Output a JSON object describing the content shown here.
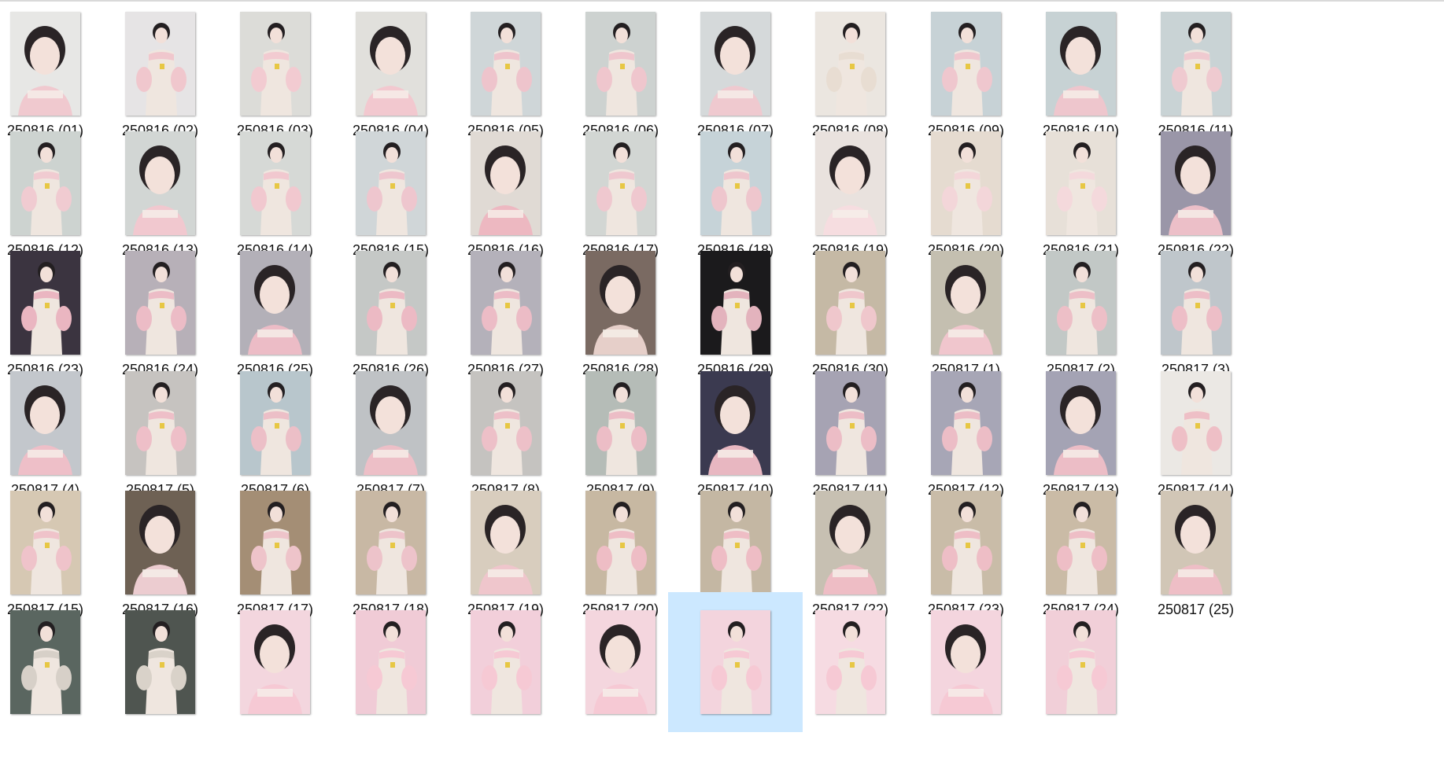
{
  "files": [
    {
      "label": "250816 (01)",
      "bg": "#e7e7e5",
      "tone": "#f0c9cf",
      "icon": "photo-icon"
    },
    {
      "label": "250816 (02)",
      "bg": "#e6e4e5",
      "tone": "#f0c7cd",
      "icon": "photo-icon"
    },
    {
      "label": "250816 (03)",
      "bg": "#dcdcd8",
      "tone": "#f2cbd1",
      "icon": "photo-icon"
    },
    {
      "label": "250816 (04)",
      "bg": "#e1e0dc",
      "tone": "#f2c8cf",
      "icon": "photo-icon"
    },
    {
      "label": "250816 (05)",
      "bg": "#cfd6d8",
      "tone": "#eec4cc",
      "icon": "photo-icon"
    },
    {
      "label": "250816 (06)",
      "bg": "#cdd2d0",
      "tone": "#efc6cd",
      "icon": "photo-icon"
    },
    {
      "label": "250816 (07)",
      "bg": "#d5d9da",
      "tone": "#efc9cf",
      "icon": "photo-icon"
    },
    {
      "label": "250816 (08)",
      "bg": "#ebe6e0",
      "tone": "#e8ddd2",
      "icon": "photo-icon"
    },
    {
      "label": "250816 (09)",
      "bg": "#c7d2d6",
      "tone": "#efc7ce",
      "icon": "photo-icon"
    },
    {
      "label": "250816 (10)",
      "bg": "#c7d2d4",
      "tone": "#eec6cd",
      "icon": "photo-icon"
    },
    {
      "label": "250816 (11)",
      "bg": "#c9d3d5",
      "tone": "#efcad0",
      "icon": "photo-icon"
    },
    {
      "label": "250816 (12)",
      "bg": "#cdd3d0",
      "tone": "#f0cbd1",
      "icon": "photo-icon"
    },
    {
      "label": "250816 (13)",
      "bg": "#d2d6d4",
      "tone": "#f1c8cf",
      "icon": "photo-icon"
    },
    {
      "label": "250816 (14)",
      "bg": "#d6d9d6",
      "tone": "#f1c8cf",
      "icon": "photo-icon"
    },
    {
      "label": "250816 (15)",
      "bg": "#d0d6d8",
      "tone": "#eec6ce",
      "icon": "photo-icon"
    },
    {
      "label": "250816 (16)",
      "bg": "#e0dad4",
      "tone": "#edb8c1",
      "icon": "photo-icon"
    },
    {
      "label": "250816 (17)",
      "bg": "#d2d6d3",
      "tone": "#efc8cf",
      "icon": "photo-icon"
    },
    {
      "label": "250816 (18)",
      "bg": "#c6d3d8",
      "tone": "#eec6cd",
      "icon": "photo-icon"
    },
    {
      "label": "250816 (19)",
      "bg": "#e9e2de",
      "tone": "#f6dde0",
      "icon": "photo-icon"
    },
    {
      "label": "250816 (20)",
      "bg": "#e5dbd0",
      "tone": "#f3d6d9",
      "icon": "photo-icon"
    },
    {
      "label": "250816 (21)",
      "bg": "#e7e0d8",
      "tone": "#f4d9dc",
      "icon": "photo-icon"
    },
    {
      "label": "250816 (22)",
      "bg": "#9a96a8",
      "tone": "#ecbfc8",
      "icon": "photo-icon"
    },
    {
      "label": "250816 (23)",
      "bg": "#3b3440",
      "tone": "#eab6c1",
      "icon": "photo-icon"
    },
    {
      "label": "250816 (24)",
      "bg": "#b7b0b8",
      "tone": "#ecbcc6",
      "icon": "photo-icon"
    },
    {
      "label": "250816 (25)",
      "bg": "#b3b0b8",
      "tone": "#ecbcc6",
      "icon": "photo-icon"
    },
    {
      "label": "250816 (26)",
      "bg": "#c5c8c6",
      "tone": "#ecbac4",
      "icon": "photo-icon"
    },
    {
      "label": "250816 (27)",
      "bg": "#b4b1ba",
      "tone": "#ecbcc6",
      "icon": "photo-icon"
    },
    {
      "label": "250816 (28)",
      "bg": "#7a6a62",
      "tone": "#e6cfc9",
      "icon": "photo-icon"
    },
    {
      "label": "250816 (29)",
      "bg": "#1b1a1c",
      "tone": "#e3b3bd",
      "icon": "photo-icon"
    },
    {
      "label": "250816 (30)",
      "bg": "#c5b9a5",
      "tone": "#efc7cc",
      "icon": "photo-icon"
    },
    {
      "label": "250817 (1)",
      "bg": "#c4bfb0",
      "tone": "#f0c6cd",
      "icon": "photo-icon"
    },
    {
      "label": "250817 (2)",
      "bg": "#c2c8c6",
      "tone": "#edbfc7",
      "icon": "photo-icon"
    },
    {
      "label": "250817 (3)",
      "bg": "#bfc6cb",
      "tone": "#edbec7",
      "icon": "photo-icon"
    },
    {
      "label": "250817 (4)",
      "bg": "#c3c7cc",
      "tone": "#eebfc8",
      "icon": "photo-icon"
    },
    {
      "label": "250817 (5)",
      "bg": "#c6c3c0",
      "tone": "#eebfc8",
      "icon": "photo-icon"
    },
    {
      "label": "250817 (6)",
      "bg": "#b8c6cc",
      "tone": "#ecbfc7",
      "icon": "photo-icon"
    },
    {
      "label": "250817 (7)",
      "bg": "#bfc2c5",
      "tone": "#edbfc7",
      "icon": "photo-icon"
    },
    {
      "label": "250817 (8)",
      "bg": "#c5c3c0",
      "tone": "#edc0c8",
      "icon": "photo-icon"
    },
    {
      "label": "250817 (9)",
      "bg": "#b5bcb7",
      "tone": "#ecbdc6",
      "icon": "photo-icon"
    },
    {
      "label": "250817 (10)",
      "bg": "#3b3a50",
      "tone": "#e8b7c1",
      "icon": "photo-icon"
    },
    {
      "label": "250817 (11)",
      "bg": "#a6a3b3",
      "tone": "#ecbdc6",
      "icon": "photo-icon"
    },
    {
      "label": "250817 (12)",
      "bg": "#a7a6b6",
      "tone": "#ecbdc6",
      "icon": "photo-icon"
    },
    {
      "label": "250817 (13)",
      "bg": "#a4a3b4",
      "tone": "#ecbdc6",
      "icon": "photo-icon"
    },
    {
      "label": "250817 (14)",
      "bg": "#ebe8e4",
      "tone": "#eebfc6",
      "icon": "photo-icon"
    },
    {
      "label": "250817 (15)",
      "bg": "#d6c8b3",
      "tone": "#efc3ca",
      "icon": "photo-icon"
    },
    {
      "label": "250817 (16)",
      "bg": "#6e6154",
      "tone": "#ecccd0",
      "icon": "photo-icon"
    },
    {
      "label": "250817 (17)",
      "bg": "#a48e75",
      "tone": "#eec4ca",
      "icon": "photo-icon"
    },
    {
      "label": "250817 (18)",
      "bg": "#c8b8a4",
      "tone": "#edc3ca",
      "icon": "photo-icon"
    },
    {
      "label": "250817 (19)",
      "bg": "#d8cdbe",
      "tone": "#efc6cc",
      "icon": "photo-icon"
    },
    {
      "label": "250817 (20)",
      "bg": "#c7b8a2",
      "tone": "#eebdc5",
      "icon": "photo-icon"
    },
    {
      "label": "250817 (21)",
      "bg": "#c4b7a3",
      "tone": "#eebdc5",
      "icon": "photo-icon"
    },
    {
      "label": "250817 (22)",
      "bg": "#c7c0b2",
      "tone": "#eebdc5",
      "icon": "photo-icon"
    },
    {
      "label": "250817 (23)",
      "bg": "#c9bca8",
      "tone": "#eebec6",
      "icon": "photo-icon"
    },
    {
      "label": "250817 (24)",
      "bg": "#cabba6",
      "tone": "#eebec6",
      "icon": "photo-icon"
    },
    {
      "label": "250817 (25)",
      "bg": "#d1c6b6",
      "tone": "#eebec6",
      "icon": "photo-icon"
    },
    {
      "label": "",
      "bg": "#5a6660",
      "tone": "#d7d0c8",
      "icon": "photo-icon"
    },
    {
      "label": "",
      "bg": "#4f5550",
      "tone": "#d9d2c9",
      "icon": "photo-icon"
    },
    {
      "label": "",
      "bg": "#f3d6de",
      "tone": "#f6c9d4",
      "icon": "photo-icon"
    },
    {
      "label": "",
      "bg": "#f0cbd6",
      "tone": "#f6c9d4",
      "icon": "photo-icon"
    },
    {
      "label": "",
      "bg": "#f2cfda",
      "tone": "#f6c9d4",
      "icon": "photo-icon"
    },
    {
      "label": "",
      "bg": "#f4d6de",
      "tone": "#f6c9d4",
      "icon": "photo-icon"
    },
    {
      "label": "",
      "bg": "#f3d4dd",
      "tone": "#f6c9d4",
      "icon": "photo-icon",
      "selected": true
    },
    {
      "label": "",
      "bg": "#f6dbe2",
      "tone": "#f6c9d4",
      "icon": "photo-icon"
    },
    {
      "label": "",
      "bg": "#f4d5de",
      "tone": "#f6c9d4",
      "icon": "photo-icon"
    },
    {
      "label": "",
      "bg": "#f1cfd8",
      "tone": "#f6c9d4",
      "icon": "photo-icon"
    }
  ],
  "selection_color": "#cce8ff"
}
